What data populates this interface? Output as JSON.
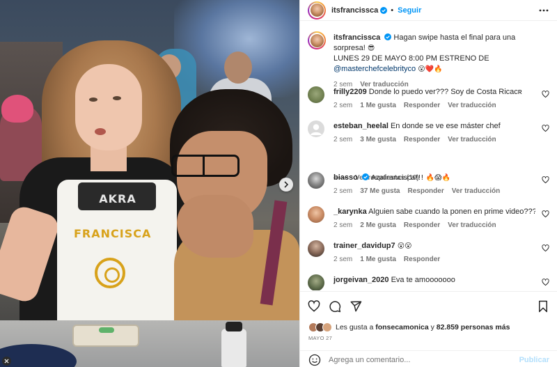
{
  "post": {
    "author": "itsfrancissca",
    "follow_label": "Seguir",
    "separator": "•",
    "caption": {
      "username": "itsfrancissca",
      "line1": "Hagan swipe hasta el final para una sorpresa!",
      "line1_emoji": "😎",
      "line2": "LUNES 29 DE MAYO 8:00 PM ESTRENO DE",
      "mention": "@masterchefcelebrityco",
      "line3_emoji": "😮❤️🔥",
      "time": "2 sem",
      "translate": "Ver traducción"
    },
    "photo": {
      "apron_top": "AKRA",
      "apron_name": "FRANCISCA"
    }
  },
  "comments": [
    {
      "username": "frilly2209",
      "text": "Donde lo puedo ver??? Soy de Costa Ricaᴄʀ",
      "time": "2 sem",
      "likes": "1 Me gusta",
      "reply": "Responder",
      "translate": "Ver traducción",
      "avatar_color": "#7a8c5a"
    },
    {
      "username": "esteban_heelal",
      "text": "En donde se ve ese máster chef",
      "time": "2 sem",
      "likes": "3 Me gusta",
      "reply": "Responder",
      "translate": "Ver traducción",
      "avatar_color": "#dcdcdc"
    },
    {
      "username": "biasso",
      "text": "Azafrancisca!!! 🔥😱🔥",
      "time": "2 sem",
      "likes": "37 Me gusta",
      "reply": "Responder",
      "translate": "Ver traducción",
      "avatar_color": "#4a4a4a"
    },
    {
      "username": "_karynka",
      "text": "Alguien sabe cuando la ponen en prime video????",
      "time": "2 sem",
      "likes": "2 Me gusta",
      "reply": "Responder",
      "translate": "Ver traducción",
      "avatar_color": "#c98b64"
    },
    {
      "username": "trainer_davidup7",
      "text": "😮😮",
      "time": "2 sem",
      "likes": "1 Me gusta",
      "reply": "Responder",
      "translate": "",
      "avatar_color": "#8a6a5a"
    },
    {
      "username": "jorgeivan_2020",
      "text": "Eva te amooooooo",
      "time": "",
      "likes": "",
      "reply": "",
      "translate": "",
      "avatar_color": "#5d6b4a"
    }
  ],
  "view_replies": "Ver respuestas (10)",
  "likes_summary": {
    "prefix": "Les gusta a",
    "user": "fonsecamonica",
    "middle": "y",
    "count": "82.859 personas más"
  },
  "date": "MAYO 27",
  "comment_input": {
    "placeholder": "Agrega un comentario...",
    "value": ""
  },
  "publish_label": "Publicar",
  "colors": {
    "accent": "#0095f6",
    "text": "#262626",
    "secondary": "#737373",
    "publish_disabled": "#b2dffc"
  },
  "icons": [
    "verified-badge-icon",
    "more-options-icon",
    "heart-icon",
    "comment-icon",
    "share-icon",
    "bookmark-icon",
    "emoji-icon",
    "chevron-right-icon",
    "close-icon"
  ]
}
